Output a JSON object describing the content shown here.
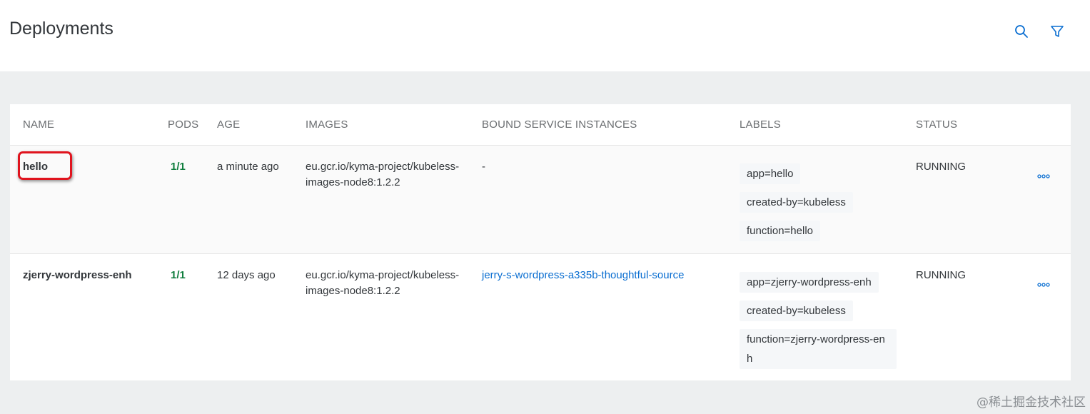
{
  "header": {
    "title": "Deployments",
    "search_icon": "search-icon",
    "filter_icon": "filter-icon"
  },
  "table": {
    "columns": {
      "name": "NAME",
      "pods": "PODS",
      "age": "AGE",
      "images": "IMAGES",
      "bound": "BOUND SERVICE INSTANCES",
      "labels": "LABELS",
      "status": "STATUS"
    },
    "rows": [
      {
        "name": "hello",
        "pods": "1/1",
        "age": "a minute ago",
        "images": "eu.gcr.io/kyma-project/kubeless-images-node8:1.2.2",
        "bound": "-",
        "labels": [
          "app=hello",
          "created-by=kubeless",
          "function=hello"
        ],
        "status": "RUNNING"
      },
      {
        "name": "zjerry-wordpress-enh",
        "pods": "1/1",
        "age": "12 days ago",
        "images": "eu.gcr.io/kyma-project/kubeless-images-node8:1.2.2",
        "bound": "jerry-s-wordpress-a335b-thoughtful-source",
        "labels": [
          "app=zjerry-wordpress-enh",
          "created-by=kubeless",
          "function=zjerry-wordpress-enh"
        ],
        "status": "RUNNING"
      }
    ]
  },
  "colors": {
    "accent": "#0a6ed1",
    "pods_ok": "#107e3e",
    "highlight": "#e0141e"
  },
  "watermark": "@稀土掘金技术社区"
}
